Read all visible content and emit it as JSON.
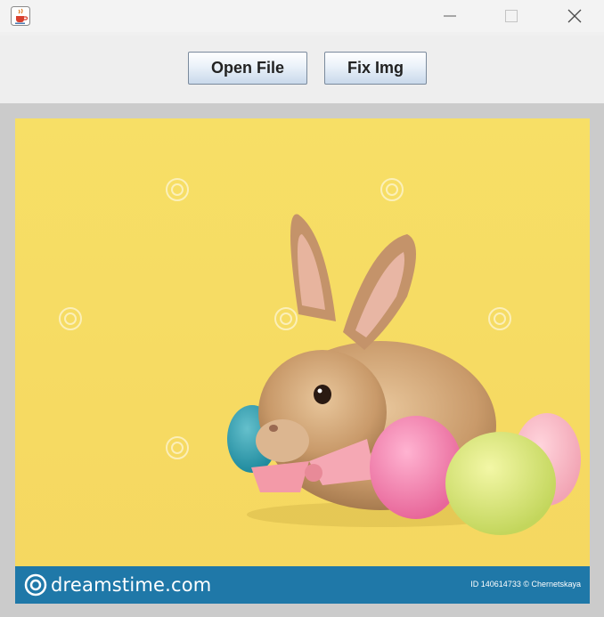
{
  "titlebar": {
    "app_icon": "java-cup-icon",
    "controls": [
      "minimize-icon",
      "maximize-icon",
      "close-icon"
    ]
  },
  "toolbar": {
    "open_label": "Open File",
    "fix_label": "Fix Img"
  },
  "image": {
    "subject": "bunny-with-easter-eggs",
    "banner_brand": "dreamstime.com",
    "banner_id": "ID 140614733 © Chernetskaya"
  },
  "colors": {
    "background_yellow": "#f7dc62",
    "banner_blue": "#1f78a8",
    "panel_gray": "#cbcbcb"
  }
}
